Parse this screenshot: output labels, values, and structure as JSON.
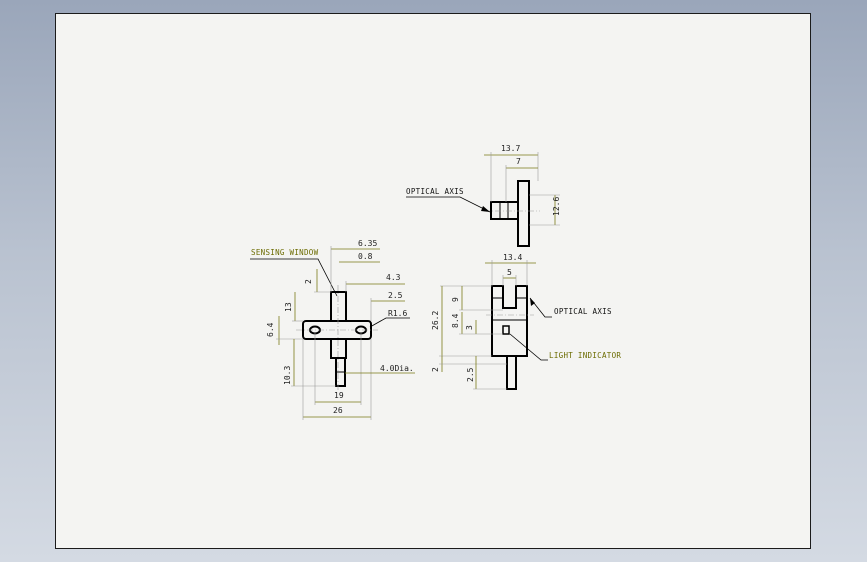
{
  "sheet": {
    "top_view": {
      "dims": {
        "overall_width": "13.7",
        "slot_offset": "7",
        "height": "12.6"
      },
      "label_optical_axis": "OPTICAL AXIS"
    },
    "front_view": {
      "label_sensing_window": "SENSING WINDOW",
      "dims": {
        "d_6_35": "6.35",
        "d_0_8": "0.8",
        "d_4_3": "4.3",
        "d_2_5": "2.5",
        "r_1_6": "R1.6",
        "d_2": "2",
        "d_13": "13",
        "d_6_4": "6.4",
        "d_10_3": "10.3",
        "d_19": "19",
        "d_26": "26",
        "d_4_dia": "4.0Dia."
      }
    },
    "side_view": {
      "label_optical_axis": "OPTICAL AXIS",
      "label_light_indicator": "LIGHT INDICATOR",
      "dims": {
        "d_13_4": "13.4",
        "d_5": "5",
        "d_9": "9",
        "d_3": "3",
        "d_8_4": "8.4",
        "d_26_2": "26.2",
        "d_2": "2",
        "d_2_5": "2.5"
      }
    }
  },
  "colors": {
    "dimension": "#7a7a18",
    "outline": "#000000",
    "sheet": "#f4f4f2",
    "background": "#b9c2d0"
  }
}
